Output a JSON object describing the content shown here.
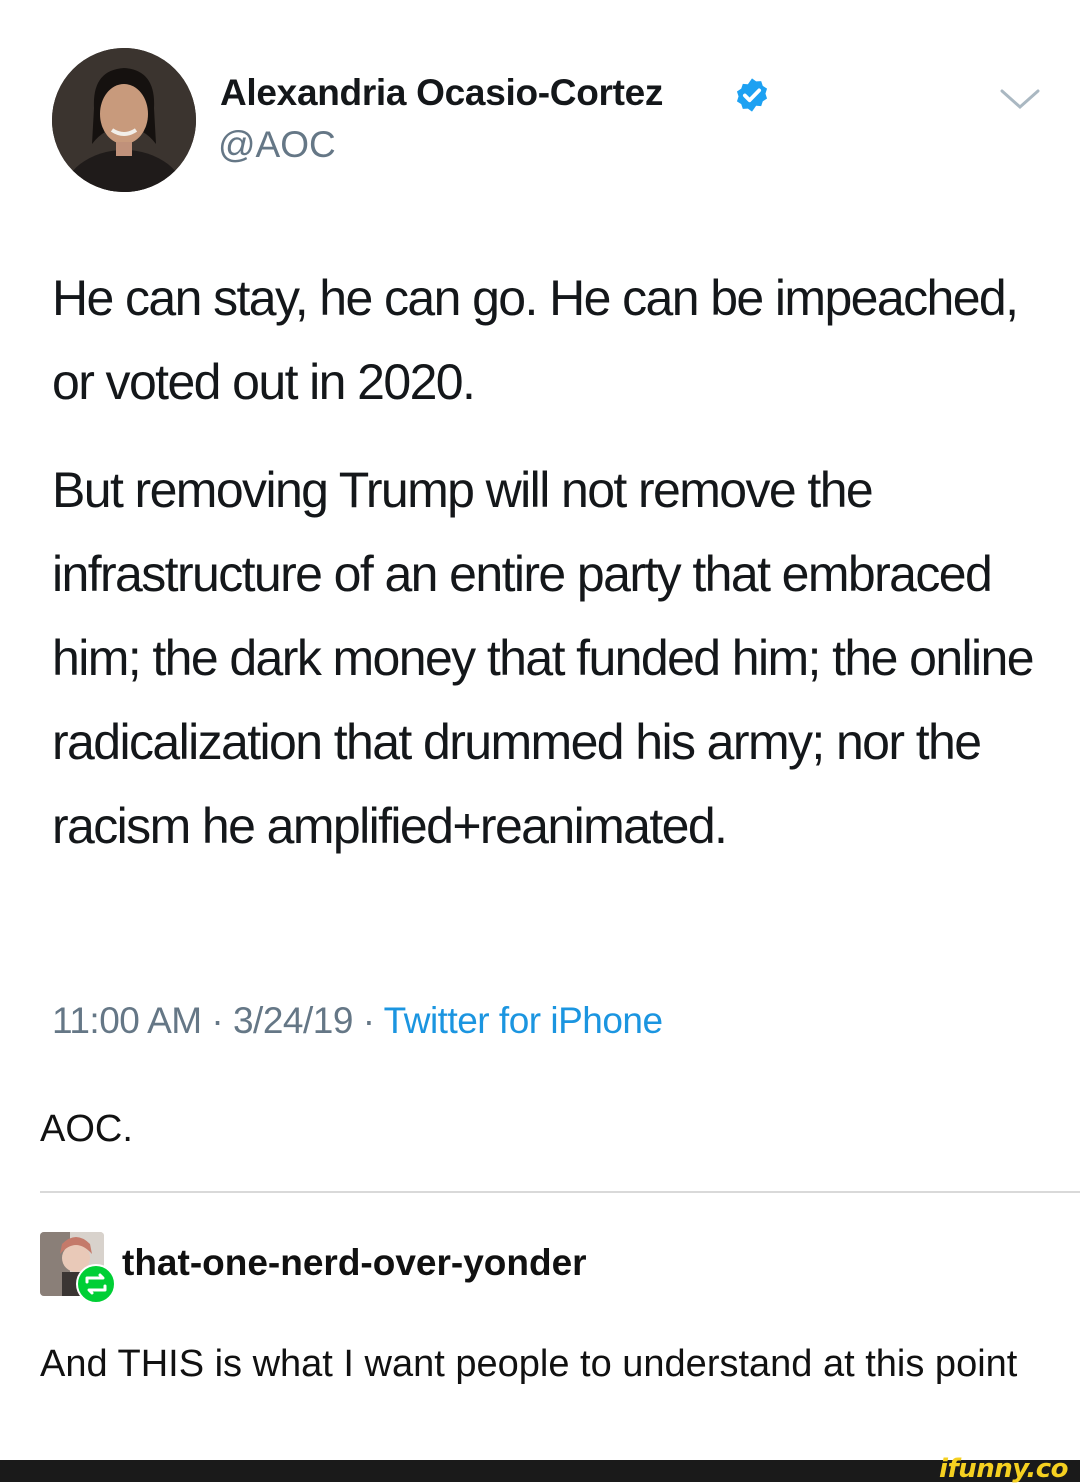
{
  "tweet": {
    "author_name": "Alexandria Ocasio-Cortez",
    "handle": "@AOC",
    "verified_icon": "verified-badge-icon",
    "menu_icon": "chevron-down-icon",
    "paragraphs": [
      "He can stay, he can go. He can be impeached, or voted out in 2020.",
      "But removing Trump will not remove the infrastructure of an entire party that embraced him; the dark money that funded him; the online radicalization that drummed his army; nor the racism he amplified+reanimated."
    ],
    "time": "11:00 AM",
    "date": "3/24/19",
    "separator": "·",
    "source": "Twitter for iPhone"
  },
  "post": {
    "caption": "AOC."
  },
  "reblog": {
    "username": "that-one-nerd-over-yonder",
    "badge_icon": "reblog-icon",
    "text": "And THIS is what I want people to understand at this point"
  },
  "watermark": "ifunny.co",
  "colors": {
    "text": "#14171a",
    "muted": "#657786",
    "link": "#1b95e0",
    "verified": "#1da1f2",
    "reblog_badge": "#00cf35",
    "watermark": "#f5d020"
  }
}
